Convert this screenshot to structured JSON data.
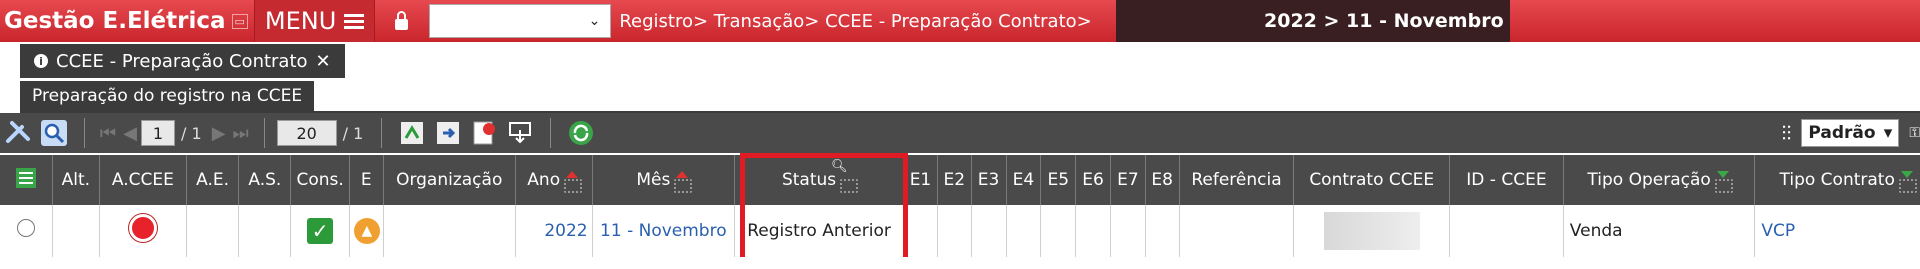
{
  "topbar": {
    "app_name": "Gestão E.Elétrica",
    "menu_label": "MENU",
    "breadcrumb": "Registro> Transação> CCEE - Preparação Contrato>",
    "period": "2022 > 11 - Novembro",
    "colors": {
      "bar": "#d63a40",
      "period_bg": "#3a1f22"
    }
  },
  "tabs": [
    {
      "label": "CCEE - Preparação Contrato",
      "close": "✕"
    }
  ],
  "section": {
    "label": "Preparação do registro na CCEE"
  },
  "toolbar": {
    "page_current": "1",
    "page_total": "/ 1",
    "rows_per_page": "20",
    "rows_total": "/ 1",
    "view_select": "Padrão"
  },
  "grid": {
    "columns": [
      "Alt.",
      "A.CCEE",
      "A.E.",
      "A.S.",
      "Cons.",
      "E",
      "Organização",
      "Ano",
      "Mês",
      "Status",
      "E1",
      "E2",
      "E3",
      "E4",
      "E5",
      "E6",
      "E7",
      "E8",
      "Referência",
      "Contrato CCEE",
      "ID - CCEE",
      "Tipo Operação",
      "Tipo Contrato"
    ],
    "rows": [
      {
        "ano": "2022",
        "mes": "11 - Novembro",
        "status": "Registro Anterior",
        "tipo_operacao": "Venda",
        "tipo_contrato": "VCP"
      }
    ]
  }
}
